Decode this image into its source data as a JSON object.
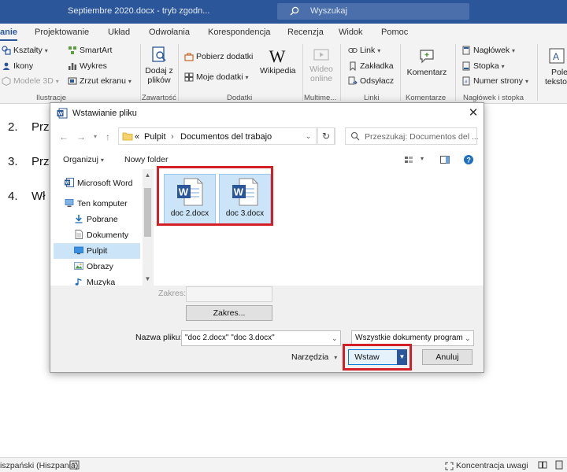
{
  "window": {
    "doc_title": "Septiembre 2020.docx  -  tryb zgodn...",
    "search_label": "Wyszukaj"
  },
  "ribbon_tabs": [
    "anie",
    "Projektowanie",
    "Układ",
    "Odwołania",
    "Korespondencja",
    "Recenzja",
    "Widok",
    "Pomoc"
  ],
  "ribbon": {
    "shapes": "Kształty",
    "icons": "Ikony",
    "models3d": "Modele 3D",
    "smartart": "SmartArt",
    "chart": "Wykres",
    "screenshot": "Zrzut ekranu",
    "add_pdf_line1": "Dodaj z",
    "add_pdf_line2": "plików",
    "get_addins": "Pobierz dodatki",
    "my_addins": "Moje dodatki",
    "wikipedia": "Wikipedia",
    "video_line1": "Wideo",
    "video_line2": "online",
    "link": "Link",
    "bookmark": "Zakładka",
    "crossref": "Odsyłacz",
    "comment": "Komentarz",
    "header": "Nagłówek",
    "footer": "Stopka",
    "page_number": "Numer strony",
    "textbox_line1": "Pole",
    "textbox_line2": "tekstow",
    "groups": [
      "Ilustracje",
      "Zawartość",
      "Dodatki",
      "Multime...",
      "Linki",
      "Komentarze",
      "Nagłówek i stopka"
    ]
  },
  "document": {
    "lines": [
      {
        "num": "2.",
        "text": "Prz"
      },
      {
        "num": "3.",
        "text": "Prz"
      },
      {
        "num": "4.",
        "text": "Wł"
      }
    ]
  },
  "dialog": {
    "title": "Wstawianie pliku",
    "address": {
      "root_glyph": "«",
      "segments": [
        "Pulpit",
        "Documentos del trabajo"
      ],
      "separator": "›"
    },
    "search_placeholder": "Przeszukaj: Documentos del ...",
    "organize": "Organizuj",
    "new_folder": "Nowy folder",
    "nav_items": [
      {
        "label": "Microsoft Word",
        "icon": "word-icon"
      },
      {
        "label": "Ten komputer",
        "icon": "computer-icon"
      },
      {
        "label": "Pobrane",
        "icon": "download-icon"
      },
      {
        "label": "Dokumenty",
        "icon": "documents-icon"
      },
      {
        "label": "Pulpit",
        "icon": "desktop-icon"
      },
      {
        "label": "Obrazy",
        "icon": "pictures-icon"
      },
      {
        "label": "Muzyka",
        "icon": "music-icon"
      }
    ],
    "selected_nav": "Pulpit",
    "files": [
      "doc 2.docx",
      "doc 3.docx"
    ],
    "range_label": "Zakres:",
    "range_button": "Zakres...",
    "filename_label": "Nazwa pliku:",
    "filename_value": "\"doc 2.docx\" \"doc 3.docx\"",
    "filetype_value": "Wszystkie dokumenty program",
    "tools": "Narzędzia",
    "insert": "Wstaw",
    "cancel": "Anuluj"
  },
  "status": {
    "language": "iszpański (Hiszpania)",
    "focus": "Koncentracja uwagi"
  },
  "colors": {
    "title_bar": "#2b579a",
    "highlight": "#d32027",
    "selection": "#cce4f7",
    "word_blue": "#2b579a"
  }
}
